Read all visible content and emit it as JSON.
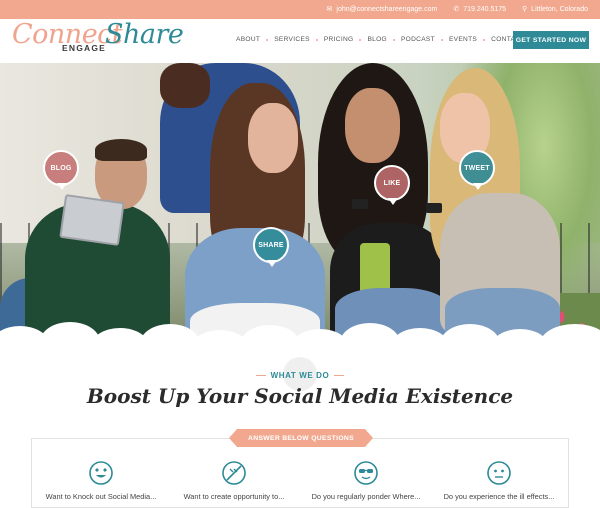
{
  "topbar": {
    "email": "john@connectshareengage.com",
    "phone": "719.240.5175",
    "location": "Littleton, Colorado",
    "icons": [
      "envelope-icon",
      "phone-icon",
      "map-pin-icon"
    ]
  },
  "logo": {
    "connect": "Connect",
    "share": "Share",
    "engage": "ENGAGE"
  },
  "nav": {
    "items": [
      "ABOUT",
      "SERVICES",
      "PRICING",
      "BLOG",
      "PODCAST",
      "EVENTS",
      "CONTACT"
    ],
    "cta": "GET STARTED NOW"
  },
  "hero": {
    "bubbles": [
      "BLOG",
      "SHARE",
      "LIKE",
      "TWEET"
    ]
  },
  "section": {
    "eyebrow": "WHAT WE DO",
    "heading": "Boost Up Your Social Media Existence",
    "ribbon": "ANSWER BELOW QUESTIONS",
    "questions": [
      {
        "text": "Want to Knock out Social Media...",
        "icon": "heart-eyes-face-icon"
      },
      {
        "text": "Want to create opportunity to...",
        "icon": "no-entry-icon"
      },
      {
        "text": "Do you regularly ponder Where...",
        "icon": "sunglasses-face-icon"
      },
      {
        "text": "Do you experience the ill effects...",
        "icon": "neutral-face-icon"
      }
    ]
  },
  "colors": {
    "accent": "#f2a88e",
    "brand": "#2d8a96"
  }
}
